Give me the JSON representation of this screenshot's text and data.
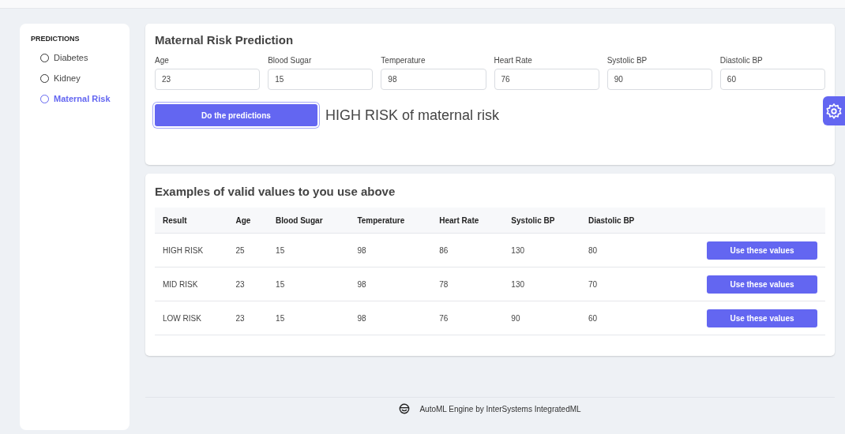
{
  "sidebar": {
    "heading": "PREDICTIONS",
    "items": [
      {
        "label": "Diabetes",
        "selected": false
      },
      {
        "label": "Kidney",
        "selected": false
      },
      {
        "label": "Maternal Risk",
        "selected": true
      }
    ]
  },
  "form": {
    "title": "Maternal Risk Prediction",
    "fields": [
      {
        "label": "Age",
        "value": "23"
      },
      {
        "label": "Blood Sugar",
        "value": "15"
      },
      {
        "label": "Temperature",
        "value": "98"
      },
      {
        "label": "Heart Rate",
        "value": "76"
      },
      {
        "label": "Systolic BP",
        "value": "90"
      },
      {
        "label": "Diastolic BP",
        "value": "60"
      }
    ],
    "button": "Do the predictions",
    "result": "HIGH RISK of maternal risk"
  },
  "examples": {
    "title": "Examples of valid values to you use above",
    "columns": [
      "Result",
      "Age",
      "Blood Sugar",
      "Temperature",
      "Heart Rate",
      "Systolic BP",
      "Diastolic BP"
    ],
    "rows": [
      {
        "cells": [
          "HIGH RISK",
          "25",
          "15",
          "98",
          "86",
          "130",
          "80"
        ],
        "button": "Use these values"
      },
      {
        "cells": [
          "MID RISK",
          "23",
          "15",
          "98",
          "78",
          "130",
          "70"
        ],
        "button": "Use these values"
      },
      {
        "cells": [
          "LOW RISK",
          "23",
          "15",
          "98",
          "76",
          "90",
          "60"
        ],
        "button": "Use these values"
      }
    ]
  },
  "footer": "AutoML Engine by InterSystems IntegratedML"
}
